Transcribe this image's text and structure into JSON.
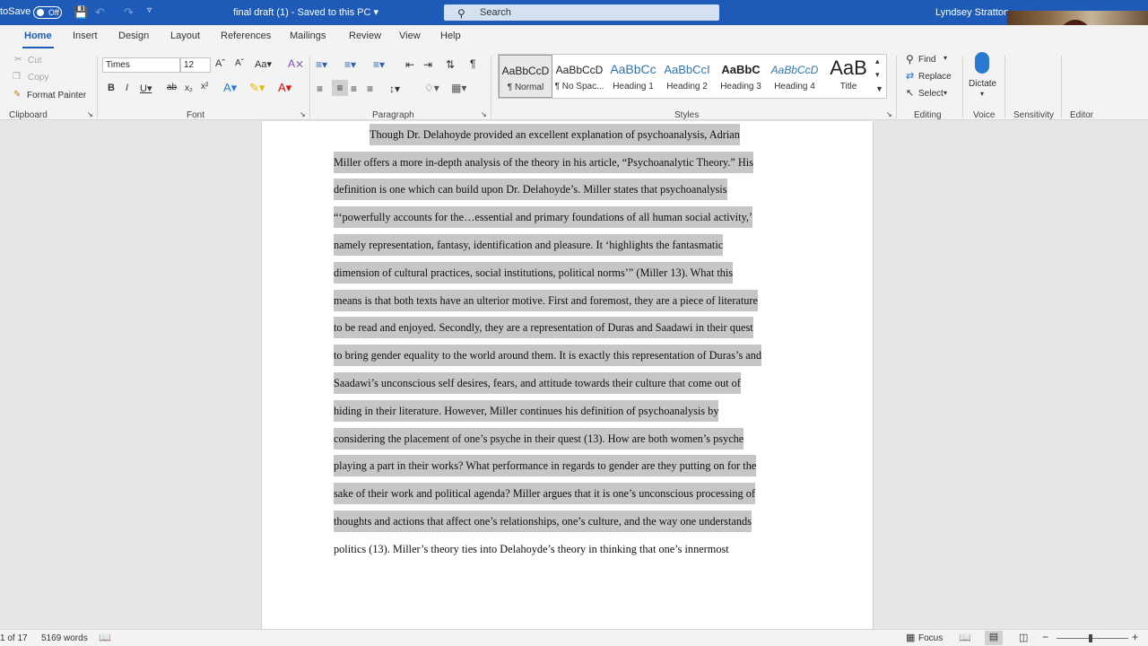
{
  "titlebar": {
    "autosave_label": "toSave",
    "toggle_label": "Off",
    "doc_title": "final draft (1)  -  Saved to this PC ▾",
    "search_placeholder": "Search",
    "user_name": "Lyndsey Stratton"
  },
  "tabs": [
    "Home",
    "Insert",
    "Design",
    "Layout",
    "References",
    "Mailings",
    "Review",
    "View",
    "Help"
  ],
  "clipboard": {
    "cut": "Cut",
    "copy": "Copy",
    "format_painter": "Format Painter",
    "label": "Clipboard"
  },
  "font": {
    "family": "Times",
    "size": "12",
    "label": "Font"
  },
  "paragraph": {
    "label": "Paragraph"
  },
  "styles": {
    "label": "Styles",
    "items": [
      {
        "preview": "AaBbCcD",
        "name": "¶ Normal"
      },
      {
        "preview": "AaBbCcD",
        "name": "¶ No Spac..."
      },
      {
        "preview": "AaBbCc",
        "name": "Heading 1"
      },
      {
        "preview": "AaBbCcI",
        "name": "Heading 2"
      },
      {
        "preview": "AaBbC",
        "name": "Heading 3"
      },
      {
        "preview": "AaBbCcD",
        "name": "Heading 4"
      },
      {
        "preview": "AaB",
        "name": "Title"
      }
    ]
  },
  "editing": {
    "find": "Find",
    "replace": "Replace",
    "select": "Select",
    "label": "Editing"
  },
  "voice": {
    "dictate": "Dictate",
    "label": "Voice"
  },
  "sensitivity_label": "Sensitivity",
  "editor_label": "Editor",
  "document": {
    "lines": [
      "Though Dr. Delahoyde provided an excellent explanation of psychoanalysis, Adrian",
      "Miller offers a more in-depth analysis of the theory in his article, “Psychoanalytic Theory.” His",
      "definition is one which can build upon Dr. Delahoyde’s. Miller states that psychoanalysis",
      "“‘powerfully accounts for the…essential and primary foundations of all human social activity,’",
      "namely representation, fantasy, identification and pleasure. It ‘highlights the fantasmatic",
      "dimension of cultural practices, social institutions, political norms’” (Miller 13). What this",
      "means is that both texts have an ulterior motive. First and foremost, they are a piece of literature",
      "to be read and enjoyed. Secondly, they are a representation of Duras and Saadawi in their quest",
      "to bring gender equality to the world around them. It is exactly this representation of Duras’s and",
      "Saadawi’s unconscious self desires, fears, and attitude towards their culture that come out of",
      "hiding in their literature. However, Miller continues his definition of psychoanalysis by",
      "considering the placement of one’s psyche in their quest (13). How are both women’s psyche",
      "playing a part in their works? What performance in regards to gender are they putting on for the",
      "sake of their work and political agenda? Miller argues that it is one’s unconscious processing of",
      "thoughts and actions that affect one’s relationships, one’s culture, and the way one understands",
      "politics (13). Miller’s theory ties into Delahoyde’s theory in thinking that one’s innermost"
    ]
  },
  "status": {
    "page": "1 of 17",
    "words": "5169 words",
    "focus": "Focus"
  }
}
